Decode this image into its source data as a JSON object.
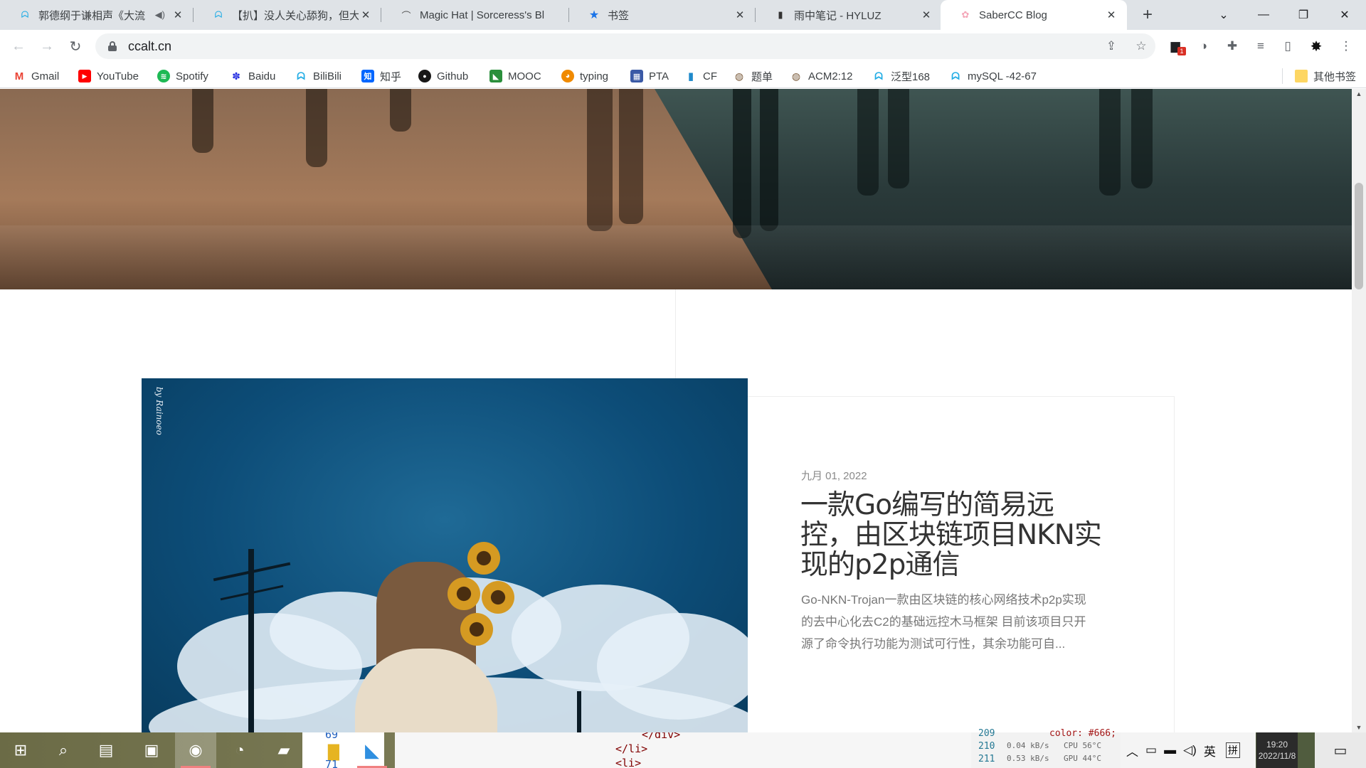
{
  "tabs": [
    {
      "title": "郭德纲于谦相声《大流",
      "favicon": "bilibili-icon",
      "audio": true
    },
    {
      "title": "【扒】没人关心舔狗，但大",
      "favicon": "bilibili-icon",
      "audio": false
    },
    {
      "title": "Magic Hat | Sorceress's Bl",
      "favicon": "magic-hat-icon",
      "audio": false
    },
    {
      "title": "书签",
      "favicon": "star-icon",
      "audio": false
    },
    {
      "title": "雨中笔记 - HYLUZ",
      "favicon": "hyluz-icon",
      "audio": false
    },
    {
      "title": "SaberCC Blog",
      "favicon": "sakura-icon",
      "audio": false,
      "active": true
    }
  ],
  "toolbar": {
    "url": "ccalt.cn",
    "badge_count": "1"
  },
  "bookmarks": [
    {
      "label": "Gmail",
      "icon": "gmail-icon",
      "color": "#ea4335",
      "glyph": "M"
    },
    {
      "label": "YouTube",
      "icon": "youtube-icon",
      "color": "#ff0000",
      "glyph": "▶"
    },
    {
      "label": "Spotify",
      "icon": "spotify-icon",
      "color": "#1db954",
      "glyph": "≋"
    },
    {
      "label": "Baidu",
      "icon": "baidu-icon",
      "color": "#2932e1",
      "glyph": "🐾"
    },
    {
      "label": "BiliBili",
      "icon": "bilibili-icon",
      "color": "#23ade5",
      "glyph": "ᗣ"
    },
    {
      "label": "知乎",
      "icon": "zhihu-icon",
      "color": "#0066ff",
      "glyph": "知"
    },
    {
      "label": "Github",
      "icon": "github-icon",
      "color": "#181717",
      "glyph": "●"
    },
    {
      "label": "MOOC",
      "icon": "mooc-icon",
      "color": "#2a8f3c",
      "glyph": "◣"
    },
    {
      "label": "typing",
      "icon": "typing-icon",
      "color": "#f08a00",
      "glyph": "◕"
    },
    {
      "label": "PTA",
      "icon": "pta-icon",
      "color": "#3b5aa6",
      "glyph": "▦"
    },
    {
      "label": "CF",
      "icon": "codeforces-icon",
      "color": "#1f8acb",
      "glyph": "▮"
    },
    {
      "label": "题单",
      "icon": "luogu-icon",
      "color": "#7a5a3a",
      "glyph": "◍"
    },
    {
      "label": "ACM2:12",
      "icon": "luogu-icon",
      "color": "#7a5a3a",
      "glyph": "◍"
    },
    {
      "label": "泛型168",
      "icon": "bilibili-icon",
      "color": "#23ade5",
      "glyph": "ᗣ"
    },
    {
      "label": "mySQL -42-67",
      "icon": "bilibili-icon",
      "color": "#23ade5",
      "glyph": "ᗣ"
    }
  ],
  "other_bookmarks": "其他书签",
  "post": {
    "date": "九月 01, 2022",
    "title": "一款Go编写的简易远控，由区块链项目NKN实现的p2p通信",
    "excerpt": "Go-NKN-Trojan一款由区块链的核心网络技术p2p实现的去中心化去C2的基础远控木马框架 目前该项目只开源了命令执行功能为测试可行性，其余功能可自...",
    "image_signature": "by Rainoeo"
  },
  "taskbar": {
    "apps": [
      "windows-start-icon",
      "search-icon",
      "task-view-icon",
      "news-icon",
      "chrome-icon",
      "edge-icon",
      "sticky-notes-icon",
      "file-explorer-icon",
      "vscode-icon"
    ],
    "explorer_lines": [
      "69",
      "71"
    ],
    "code_lines": [
      "</div>",
      "</li>",
      "<li>"
    ],
    "editor_line_numbers": [
      "209",
      "210",
      "211"
    ],
    "editor_snippet": "color: #666;",
    "net_up": "0.04 kB/s",
    "net_down": "0.53 kB/s",
    "cpu_label_1": "CPU 56°C",
    "cpu_label_2": "GPU 44°C",
    "ime_lang": "英",
    "ime_mode": "拼",
    "time": "19:20",
    "date": "2022/11/8"
  }
}
